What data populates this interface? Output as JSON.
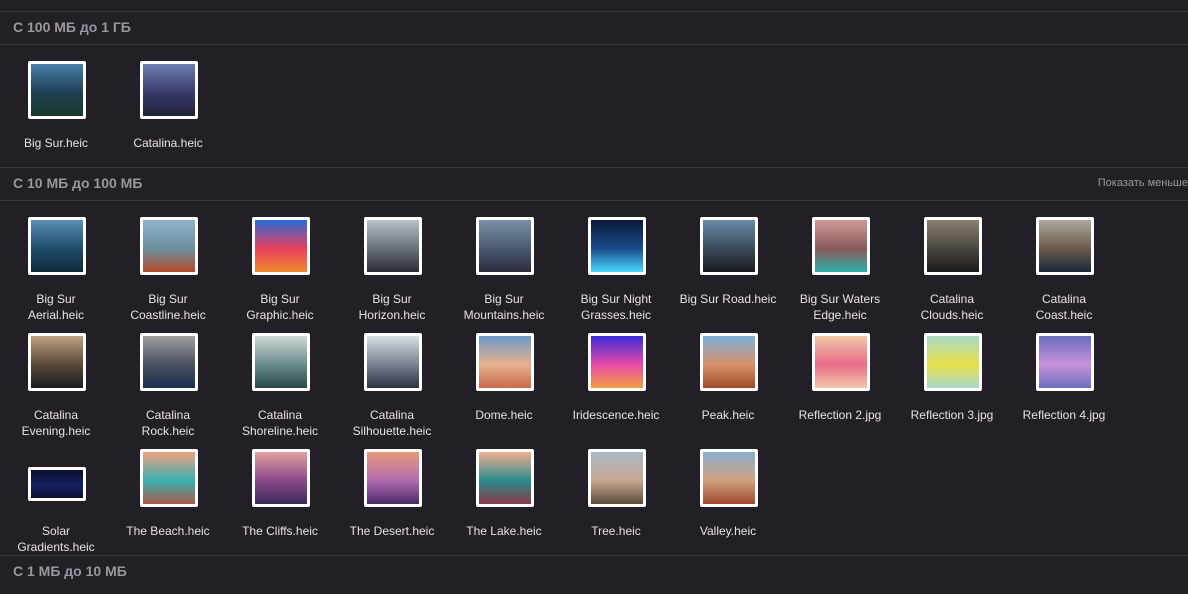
{
  "sections": {
    "s1": {
      "title": "С 100 МБ до 1 ГБ",
      "items": [
        {
          "label": "Big Sur.heic",
          "icon": "big-sur-thumbnail",
          "colors": [
            "#4a7fa8",
            "#1f3f55",
            "#1a3a2a"
          ]
        },
        {
          "label": "Catalina.heic",
          "icon": "catalina-thumbnail",
          "colors": [
            "#6b7fb0",
            "#3a3a6a",
            "#20233a"
          ]
        }
      ]
    },
    "s2": {
      "title": "С 10 МБ до 100 МБ",
      "show_less": "Показать меньше",
      "items": [
        {
          "label": "Big Sur\nAerial.heic",
          "icon": "big-sur-aerial-thumbnail",
          "colors": [
            "#5a8fb5",
            "#1f4a6a",
            "#0f2a3a"
          ]
        },
        {
          "label": "Big Sur\nCoastline.heic",
          "icon": "big-sur-coastline-thumbnail",
          "colors": [
            "#8fb3c8",
            "#6b8fa0",
            "#b34a2a"
          ]
        },
        {
          "label": "Big Sur\nGraphic.heic",
          "icon": "big-sur-graphic-thumbnail",
          "colors": [
            "#2a6ad8",
            "#e8405a",
            "#f08a30"
          ]
        },
        {
          "label": "Big Sur\nHorizon.heic",
          "icon": "big-sur-horizon-thumbnail",
          "colors": [
            "#b8c0c8",
            "#6a7078",
            "#2a2e34"
          ]
        },
        {
          "label": "Big Sur\nMountains.heic",
          "icon": "big-sur-mountains-thumbnail",
          "colors": [
            "#7a90a8",
            "#4a5a70",
            "#2a2a3a"
          ]
        },
        {
          "label": "Big Sur Night\nGrasses.heic",
          "icon": "big-sur-night-grasses-thumbnail",
          "colors": [
            "#0a1a3a",
            "#1a4a8a",
            "#4ad8ff"
          ]
        },
        {
          "label": "Big Sur Road.heic",
          "icon": "big-sur-road-thumbnail",
          "colors": [
            "#6a8aa8",
            "#3a4a5a",
            "#1a1a20"
          ]
        },
        {
          "label": "Big Sur Waters\nEdge.heic",
          "icon": "big-sur-waters-edge-thumbnail",
          "colors": [
            "#d09a9a",
            "#8a5a5a",
            "#2ab0a8"
          ]
        },
        {
          "label": "Catalina\nClouds.heic",
          "icon": "catalina-clouds-thumbnail",
          "colors": [
            "#8a8070",
            "#4a4540",
            "#1a1a1a"
          ]
        },
        {
          "label": "Catalina\nCoast.heic",
          "icon": "catalina-coast-thumbnail",
          "colors": [
            "#b0a8a0",
            "#6a5a4a",
            "#1a2a3a"
          ]
        },
        {
          "label": "Catalina\nEvening.heic",
          "icon": "catalina-evening-thumbnail",
          "colors": [
            "#c0a080",
            "#5a4a3a",
            "#1a1a20"
          ]
        },
        {
          "label": "Catalina\nRock.heic",
          "icon": "catalina-rock-thumbnail",
          "colors": [
            "#a0a0a0",
            "#4a5060",
            "#1a3050"
          ]
        },
        {
          "label": "Catalina\nShoreline.heic",
          "icon": "catalina-shoreline-thumbnail",
          "colors": [
            "#d0d8d8",
            "#6a8a8a",
            "#2a4a4a"
          ]
        },
        {
          "label": "Catalina\nSilhouette.heic",
          "icon": "catalina-silhouette-thumbnail",
          "colors": [
            "#d8e0e8",
            "#7a8090",
            "#2a3040"
          ]
        },
        {
          "label": "Dome.heic",
          "icon": "dome-thumbnail",
          "colors": [
            "#6a9ac8",
            "#e8b090",
            "#c86a4a"
          ]
        },
        {
          "label": "Iridescence.heic",
          "icon": "iridescence-thumbnail",
          "colors": [
            "#3a2ad8",
            "#e84aa8",
            "#f0a040"
          ]
        },
        {
          "label": "Peak.heic",
          "icon": "peak-thumbnail",
          "colors": [
            "#7ab0d8",
            "#d8906a",
            "#a04a2a"
          ]
        },
        {
          "label": "Reflection 2.jpg",
          "icon": "reflection-2-thumbnail",
          "colors": [
            "#f0c8a8",
            "#e86a8a",
            "#f0c8a8"
          ]
        },
        {
          "label": "Reflection 3.jpg",
          "icon": "reflection-3-thumbnail",
          "colors": [
            "#a8d8c8",
            "#e8e04a",
            "#a8d8c8"
          ]
        },
        {
          "label": "Reflection 4.jpg",
          "icon": "reflection-4-thumbnail",
          "colors": [
            "#6a70c0",
            "#c890d8",
            "#6a70c0"
          ]
        },
        {
          "label": "Solar\nGradients.heic",
          "icon": "solar-gradients-thumbnail",
          "colors": [
            "#0a0f30",
            "#142060",
            "#0a0f30"
          ],
          "wide": true
        },
        {
          "label": "The Beach.heic",
          "icon": "the-beach-thumbnail",
          "colors": [
            "#f0a080",
            "#3ab0b0",
            "#a85a4a"
          ]
        },
        {
          "label": "The Cliffs.heic",
          "icon": "the-cliffs-thumbnail",
          "colors": [
            "#e0a0a0",
            "#8a4a8a",
            "#3a2a5a"
          ]
        },
        {
          "label": "The Desert.heic",
          "icon": "the-desert-thumbnail",
          "colors": [
            "#e89a7a",
            "#b06ab0",
            "#4a2a6a"
          ]
        },
        {
          "label": "The Lake.heic",
          "icon": "the-lake-thumbnail",
          "colors": [
            "#f0b090",
            "#2a8a8a",
            "#8a3a4a"
          ]
        },
        {
          "label": "Tree.heic",
          "icon": "tree-thumbnail",
          "colors": [
            "#a8b8c8",
            "#c8a890",
            "#5a4a3a"
          ]
        },
        {
          "label": "Valley.heic",
          "icon": "valley-thumbnail",
          "colors": [
            "#8ab0d0",
            "#d0a080",
            "#a04a2a"
          ]
        }
      ]
    },
    "s3": {
      "title": "С 1 МБ до 10 МБ"
    }
  }
}
